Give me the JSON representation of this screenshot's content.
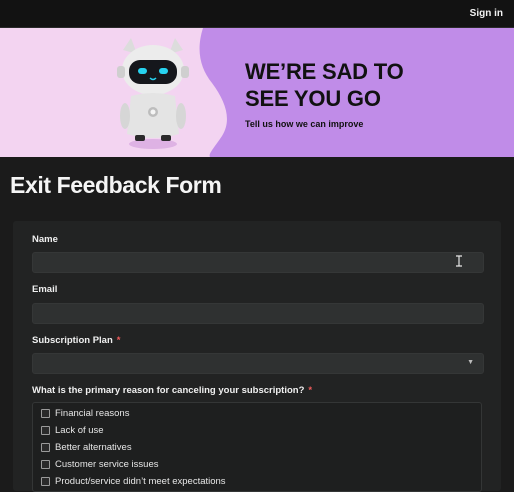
{
  "topbar": {
    "signin_label": "Sign in"
  },
  "banner": {
    "headline_line1": "WE’RE SAD TO",
    "headline_line2": "SEE YOU GO",
    "subline": "Tell us how we can improve"
  },
  "form": {
    "title": "Exit Feedback Form",
    "name_label": "Name",
    "name_value": "",
    "email_label": "Email",
    "email_value": "",
    "plan_label": "Subscription Plan",
    "plan_value": "",
    "required_mark": "*",
    "reason_label": "What is the primary reason for canceling your subscription?",
    "reasons": [
      "Financial reasons",
      "Lack of use",
      "Better alternatives",
      "Customer service issues",
      "Product/service didn’t meet expectations"
    ]
  },
  "colors": {
    "banner_pink": "#f3d4f1",
    "banner_purple": "#c08ce8",
    "required": "#ef5b5b"
  }
}
